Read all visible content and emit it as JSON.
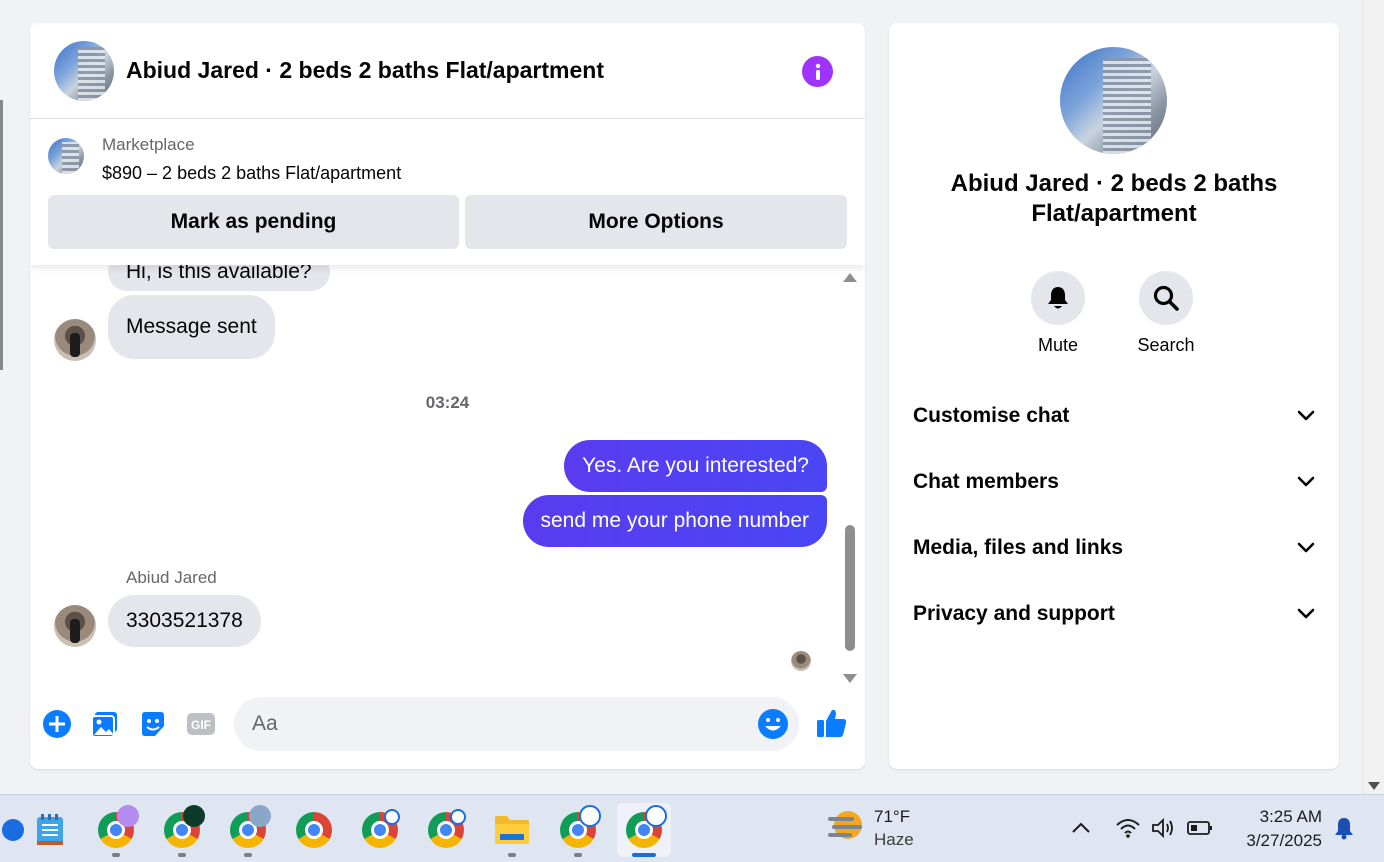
{
  "chat": {
    "title": "Abiud Jared · 2 beds 2 baths Flat/apartment",
    "marketplace": {
      "label": "Marketplace",
      "listing": "$890 – 2 beds 2 baths Flat/apartment",
      "mark_pending": "Mark as pending",
      "more_options": "More Options"
    },
    "messages": {
      "partial_in": "Hi, is this available?",
      "sent_notice": "Message sent",
      "timestamp": "03:24",
      "out_1": "Yes. Are you interested?",
      "out_2": "send me your phone number",
      "sender": "Abiud Jared",
      "in_phone": "3303521378"
    },
    "composer": {
      "placeholder": "Aa"
    }
  },
  "info": {
    "title": "Abiud Jared · 2 beds 2 baths Flat/apartment",
    "mute": "Mute",
    "search": "Search",
    "sections": [
      "Customise chat",
      "Chat members",
      "Media, files and links",
      "Privacy and support"
    ]
  },
  "taskbar": {
    "weather_temp": "71°F",
    "weather_cond": "Haze",
    "time": "3:25 AM",
    "date": "3/27/2025"
  },
  "colors": {
    "accent_purple": "#a033ff",
    "outgoing_bubble": "#5b3cf5",
    "messenger_blue": "#0a7cff"
  }
}
